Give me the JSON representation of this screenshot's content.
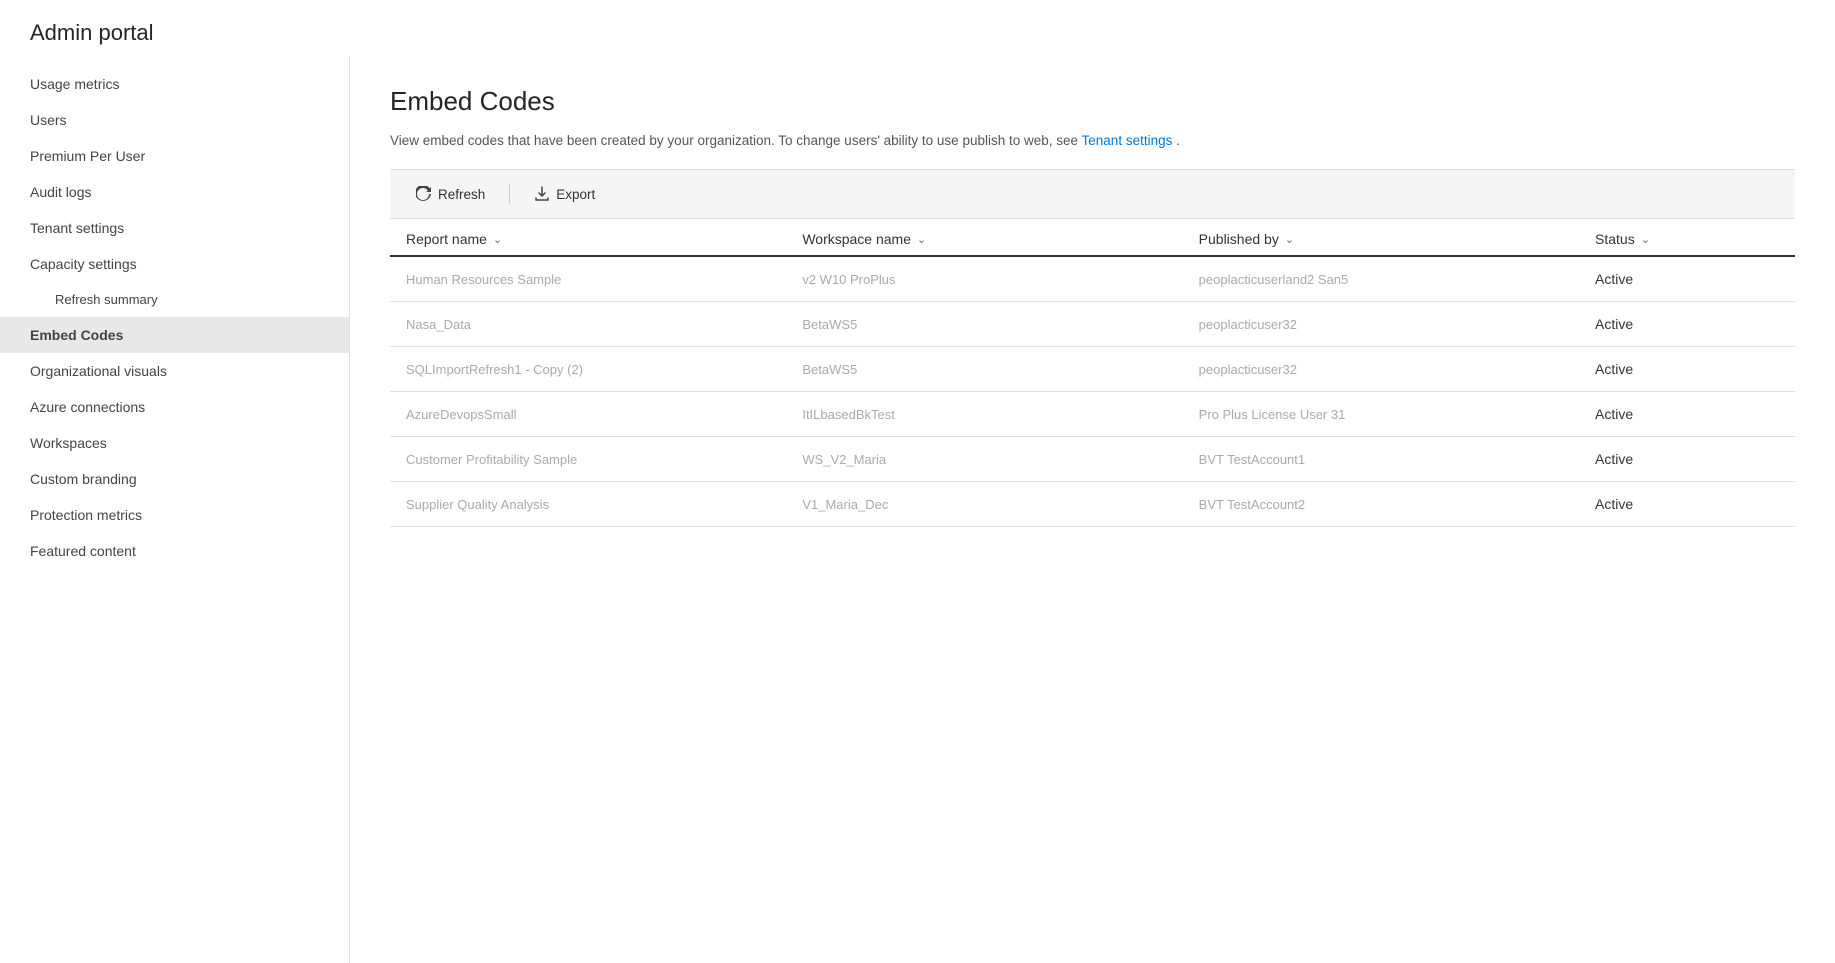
{
  "header": {
    "title": "Admin portal"
  },
  "sidebar": {
    "items": [
      {
        "id": "usage-metrics",
        "label": "Usage metrics",
        "active": false,
        "sub": false
      },
      {
        "id": "users",
        "label": "Users",
        "active": false,
        "sub": false
      },
      {
        "id": "premium-per-user",
        "label": "Premium Per User",
        "active": false,
        "sub": false
      },
      {
        "id": "audit-logs",
        "label": "Audit logs",
        "active": false,
        "sub": false
      },
      {
        "id": "tenant-settings",
        "label": "Tenant settings",
        "active": false,
        "sub": false
      },
      {
        "id": "capacity-settings",
        "label": "Capacity settings",
        "active": false,
        "sub": false
      },
      {
        "id": "refresh-summary",
        "label": "Refresh summary",
        "active": false,
        "sub": true
      },
      {
        "id": "embed-codes",
        "label": "Embed Codes",
        "active": true,
        "sub": false
      },
      {
        "id": "organizational-visuals",
        "label": "Organizational visuals",
        "active": false,
        "sub": false
      },
      {
        "id": "azure-connections",
        "label": "Azure connections",
        "active": false,
        "sub": false
      },
      {
        "id": "workspaces",
        "label": "Workspaces",
        "active": false,
        "sub": false
      },
      {
        "id": "custom-branding",
        "label": "Custom branding",
        "active": false,
        "sub": false
      },
      {
        "id": "protection-metrics",
        "label": "Protection metrics",
        "active": false,
        "sub": false
      },
      {
        "id": "featured-content",
        "label": "Featured content",
        "active": false,
        "sub": false
      }
    ]
  },
  "content": {
    "page_title": "Embed Codes",
    "description": "View embed codes that have been created by your organization. To change users' ability to use publish to web, see ",
    "description_link_text": "Tenant settings",
    "description_suffix": ".",
    "toolbar": {
      "refresh_label": "Refresh",
      "export_label": "Export"
    },
    "table": {
      "columns": [
        {
          "id": "report-name",
          "label": "Report name"
        },
        {
          "id": "workspace-name",
          "label": "Workspace name"
        },
        {
          "id": "published-by",
          "label": "Published by"
        },
        {
          "id": "status",
          "label": "Status"
        }
      ],
      "rows": [
        {
          "report_name": "Human Resources Sample",
          "workspace_name": "v2 W10 ProPlus",
          "published_by": "peoplacticuserland2 San5",
          "status": "Active"
        },
        {
          "report_name": "Nasa_Data",
          "workspace_name": "BetaWS5",
          "published_by": "peoplacticuser32",
          "status": "Active"
        },
        {
          "report_name": "SQLImportRefresh1 - Copy (2)",
          "workspace_name": "BetaWS5",
          "published_by": "peoplacticuser32",
          "status": "Active"
        },
        {
          "report_name": "AzureDevopsSmall",
          "workspace_name": "ItILbasedBkTest",
          "published_by": "Pro Plus License User 31",
          "status": "Active"
        },
        {
          "report_name": "Customer Profitability Sample",
          "workspace_name": "WS_V2_Maria",
          "published_by": "BVT TestAccount1",
          "status": "Active"
        },
        {
          "report_name": "Supplier Quality Analysis",
          "workspace_name": "V1_Maria_Dec",
          "published_by": "BVT TestAccount2",
          "status": "Active"
        }
      ]
    }
  }
}
